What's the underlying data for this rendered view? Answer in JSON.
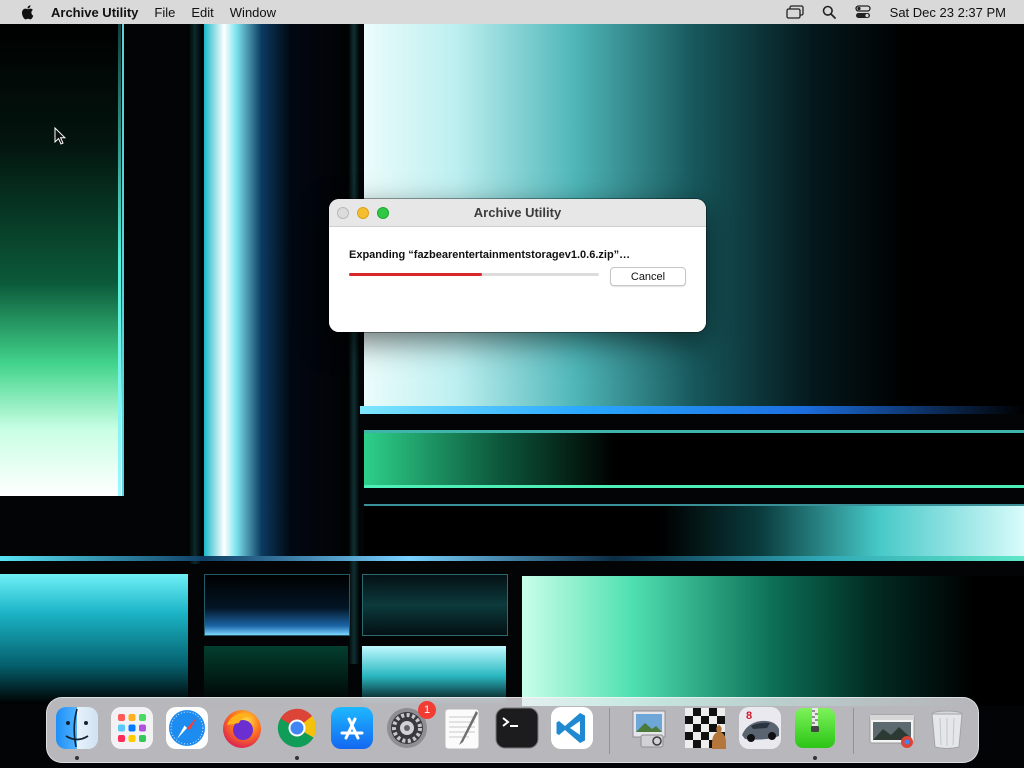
{
  "menubar": {
    "app_name": "Archive Utility",
    "items": [
      {
        "label": "File"
      },
      {
        "label": "Edit"
      },
      {
        "label": "Window"
      }
    ],
    "clock": "Sat Dec 23  2:37 PM"
  },
  "dialog": {
    "title": "Archive Utility",
    "message": "Expanding “fazbearentertainmentstoragev1.0.6.zip”…",
    "progress": 0.53,
    "cancel_label": "Cancel"
  },
  "dock": {
    "items": [
      {
        "name": "finder-icon",
        "running": true
      },
      {
        "name": "launchpad-icon",
        "running": false
      },
      {
        "name": "safari-icon",
        "running": false
      },
      {
        "name": "firefox-icon",
        "running": false
      },
      {
        "name": "chrome-icon",
        "running": true
      },
      {
        "name": "app-store-icon",
        "running": false
      },
      {
        "name": "system-settings-icon",
        "running": false,
        "badge": "1"
      },
      {
        "name": "textedit-icon",
        "running": false
      },
      {
        "name": "terminal-icon",
        "running": false
      },
      {
        "name": "vscode-icon",
        "running": false
      },
      {
        "name": "preview-icon",
        "running": false
      },
      {
        "name": "chess-icon",
        "running": false
      },
      {
        "name": "racing-game-icon",
        "running": false
      },
      {
        "name": "archive-utility-icon",
        "running": true
      },
      {
        "name": "chrome-window-icon",
        "running": false
      },
      {
        "name": "trash-icon",
        "running": false
      }
    ]
  },
  "colors": {
    "progress_fill": "#d9262b",
    "badge": "#f23b33",
    "menubar": "#d9d9d9"
  }
}
